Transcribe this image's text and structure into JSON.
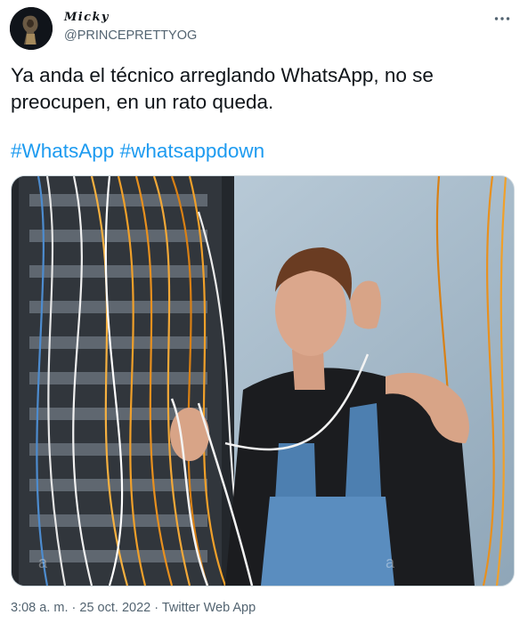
{
  "user": {
    "display_name": "Micky",
    "handle": "@PRINCEPRETTYOG"
  },
  "more_icon": "more-horizontal-icon",
  "tweet": {
    "text_line1": "Ya anda el técnico arreglando WhatsApp, no se",
    "text_line2": "preocupen, en un rato queda.",
    "hashtags": [
      "#WhatsApp",
      "#whatsappdown"
    ]
  },
  "media": {
    "watermark": "a"
  },
  "meta": {
    "time": "3:08 a. m.",
    "separator1": "·",
    "date": "25 oct. 2022",
    "separator2": "·",
    "source": "Twitter Web App"
  },
  "colors": {
    "link": "#1d9bf0",
    "secondary_text": "#536471",
    "primary_text": "#0f1419",
    "border": "#cfd9de"
  }
}
